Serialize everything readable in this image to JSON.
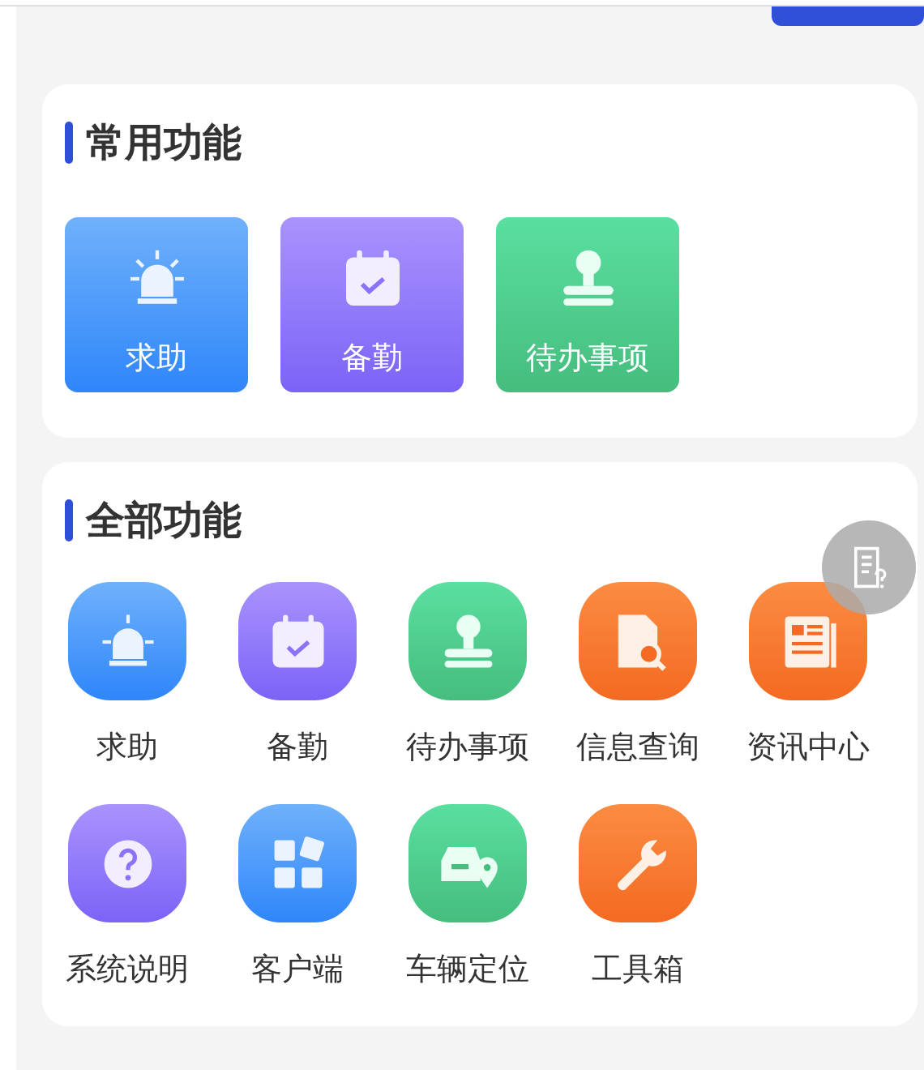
{
  "common": {
    "title": "常用功能",
    "items": [
      {
        "label": "求助",
        "kind": "alarm"
      },
      {
        "label": "备勤",
        "kind": "calendar"
      },
      {
        "label": "待办事项",
        "kind": "stamp"
      }
    ]
  },
  "all": {
    "title": "全部功能",
    "items": [
      {
        "label": "求助",
        "kind": "alarm"
      },
      {
        "label": "备勤",
        "kind": "calendar"
      },
      {
        "label": "待办事项",
        "kind": "stamp"
      },
      {
        "label": "信息查询",
        "kind": "docsearch"
      },
      {
        "label": "资讯中心",
        "kind": "news"
      },
      {
        "label": "系统说明",
        "kind": "question"
      },
      {
        "label": "客户端",
        "kind": "apps"
      },
      {
        "label": "车辆定位",
        "kind": "carpin"
      },
      {
        "label": "工具箱",
        "kind": "wrench"
      }
    ]
  }
}
